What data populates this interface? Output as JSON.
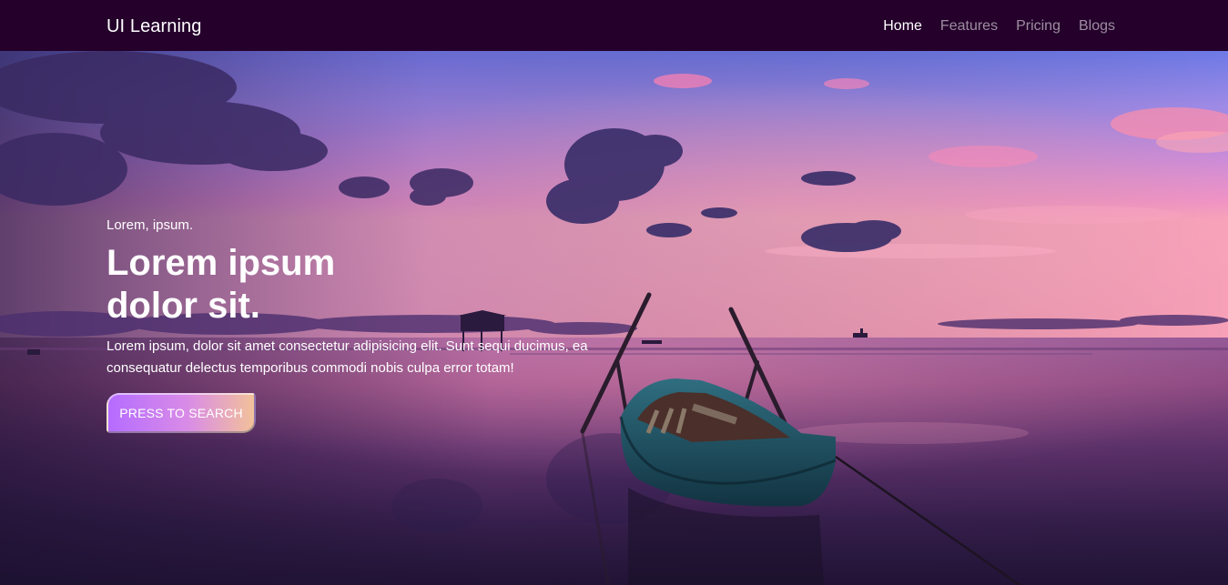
{
  "navbar": {
    "brand": "UI Learning",
    "links": [
      {
        "label": "Home",
        "active": true
      },
      {
        "label": "Features",
        "active": false
      },
      {
        "label": "Pricing",
        "active": false
      },
      {
        "label": "Blogs",
        "active": false
      }
    ]
  },
  "hero": {
    "eyebrow": "Lorem, ipsum.",
    "headline": "Lorem ipsum dolor sit.",
    "description": "Lorem ipsum, dolor sit amet consectetur adipisicing elit. Sunt sequi ducimus, ea consequatur delectus temporibus commodi nobis culpa error totam!",
    "cta_label": "PRESS TO SEARCH",
    "background_image": "sunset-lake-boat-photo"
  },
  "colors": {
    "navbar_bg": "#24002b",
    "cta_gradient_start": "#b56cff",
    "cta_gradient_end": "#f2c19a"
  }
}
